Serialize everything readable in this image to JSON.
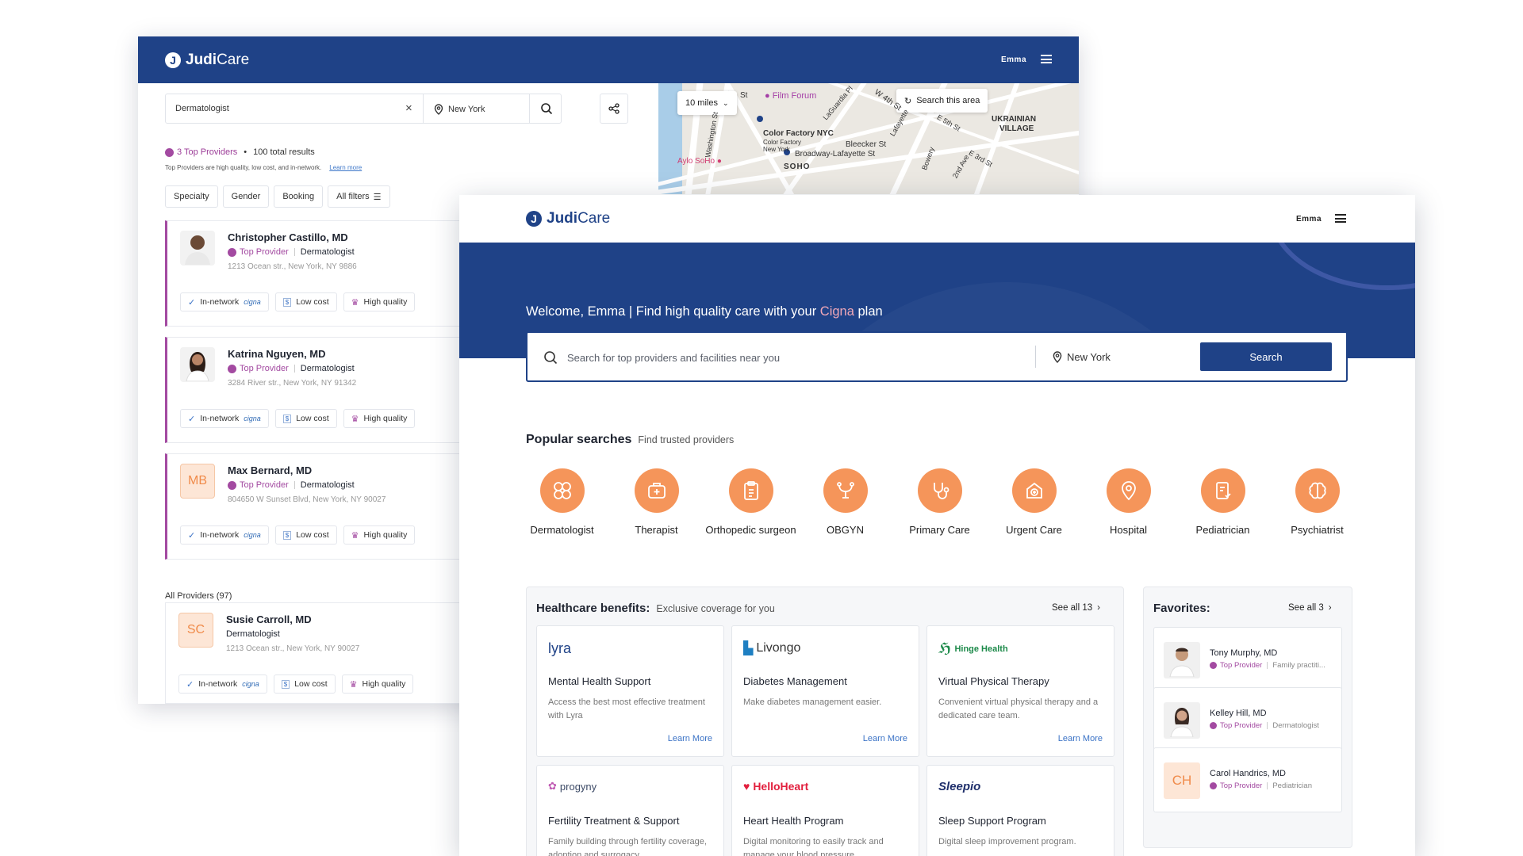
{
  "back": {
    "logo": {
      "bold": "Judi",
      "rest": "Care"
    },
    "user": "Emma",
    "search": {
      "query": "Dermatologist",
      "location": "New York"
    },
    "summary": {
      "top_providers": "3 Top Providers",
      "total": "100 total results"
    },
    "note": {
      "text": "Top Providers are high quality, low cost, and in-network.",
      "link": "Learn more"
    },
    "filters": [
      "Specialty",
      "Gender",
      "Booking",
      "All filters"
    ],
    "map": {
      "radius": "10 miles",
      "search_area": "Search this area",
      "labels": {
        "film_forum": "Film Forum",
        "color_factory": "Color Factory NYC",
        "color_factory_sub": "Color Factory",
        "color_factory_sub2": "New York",
        "bleecker": "Bleecker St",
        "broadway": "Broadway-Lafayette St",
        "soho": "SOHO",
        "ukrainian": "UKRAINIAN",
        "village": "VILLAGE",
        "aylo": "Aylo SoHo",
        "st": "St",
        "washington": "Washington St",
        "w4th": "W 4th St",
        "lafayette": "Lafayette",
        "e5th": "E 5th St",
        "e3rd": "E 3rd St",
        "bowery": "Bowery",
        "ave2": "2nd Ave",
        "laguardia": "LaGuardia Pl"
      }
    },
    "providers": [
      {
        "name": "Christopher Castillo, MD",
        "badge": "Top Provider",
        "specialty": "Dermatologist",
        "address": "1213 Ocean str., New York, NY 9886",
        "initials": ""
      },
      {
        "name": "Katrina Nguyen, MD",
        "badge": "Top Provider",
        "specialty": "Dermatologist",
        "address": "3284 River str., New York, NY 91342",
        "initials": ""
      },
      {
        "name": "Max Bernard, MD",
        "badge": "Top Provider",
        "specialty": "Dermatologist",
        "address": "804650 W Sunset Blvd, New York, NY 90027",
        "initials": "MB"
      }
    ],
    "tags": {
      "in_network": "In-network",
      "cigna": "cigna",
      "low_cost": "Low cost",
      "high_quality": "High quality"
    },
    "all_providers": "All Providers (97)",
    "all_list": [
      {
        "name": "Susie Carroll, MD",
        "specialty": "Dermatologist",
        "address": "1213 Ocean str., New York, NY 90027",
        "initials": "SC"
      }
    ]
  },
  "front": {
    "logo": {
      "bold": "Judi",
      "rest": "Care"
    },
    "user": "Emma",
    "welcome": {
      "prefix": "Welcome, Emma | Find high quality care with your ",
      "plan": "Cigna",
      "suffix": " plan"
    },
    "search": {
      "placeholder": "Search for top providers and facilities near you",
      "location": "New York",
      "button": "Search"
    },
    "popular": {
      "title": "Popular searches",
      "subtitle": "Find trusted providers"
    },
    "categories": [
      {
        "label": "Dermatologist",
        "icon": "dermatology-icon"
      },
      {
        "label": "Therapist",
        "icon": "briefcase-medical-icon"
      },
      {
        "label": "Orthopedic surgeon",
        "icon": "clipboard-icon"
      },
      {
        "label": "OBGYN",
        "icon": "obgyn-icon"
      },
      {
        "label": "Primary Care",
        "icon": "stethoscope-icon"
      },
      {
        "label": "Urgent Care",
        "icon": "urgent-care-icon"
      },
      {
        "label": "Hospital",
        "icon": "location-pin-icon"
      },
      {
        "label": "Pediatrician",
        "icon": "pediatrics-icon"
      },
      {
        "label": "Psychiatrist",
        "icon": "brain-icon"
      }
    ],
    "benefits": {
      "title": "Healthcare benefits:",
      "subtitle": "Exclusive coverage for you",
      "see_all": "See all 13",
      "items": [
        {
          "brand": "lyra",
          "title": "Mental Health Support",
          "desc": "Access the best most effective treatment with Lyra",
          "more": "Learn More"
        },
        {
          "brand": "Livongo",
          "title": "Diabetes Management",
          "desc": "Make diabetes management easier.",
          "more": "Learn More"
        },
        {
          "brand": "Hinge Health",
          "title": "Virtual Physical Therapy",
          "desc": "Convenient virtual physical therapy and a dedicated care team.",
          "more": "Learn More"
        },
        {
          "brand": "progyny",
          "title": "Fertility Treatment & Support",
          "desc": "Family building through fertility coverage, adoption and surrogacy.",
          "more": ""
        },
        {
          "brand": "HelloHeart",
          "title": "Heart Health Program",
          "desc": "Digital monitoring to easily track and manage your blood pressure.",
          "more": ""
        },
        {
          "brand": "Sleepio",
          "title": "Sleep Support Program",
          "desc": "Digital sleep improvement program.",
          "more": ""
        }
      ]
    },
    "favorites": {
      "title": "Favorites:",
      "see_all": "See all 3",
      "items": [
        {
          "name": "Tony Murphy, MD",
          "badge": "Top Provider",
          "specialty": "Family practiti...",
          "initials": ""
        },
        {
          "name": "Kelley Hill, MD",
          "badge": "Top Provider",
          "specialty": "Dermatologist",
          "initials": ""
        },
        {
          "name": "Carol Handrics, MD",
          "badge": "Top Provider",
          "specialty": "Pediatrician",
          "initials": "CH"
        }
      ]
    }
  },
  "colors": {
    "navy": "#1f4287",
    "orange": "#f5955a",
    "purple": "#a34aa1",
    "link": "#3b73c6"
  }
}
